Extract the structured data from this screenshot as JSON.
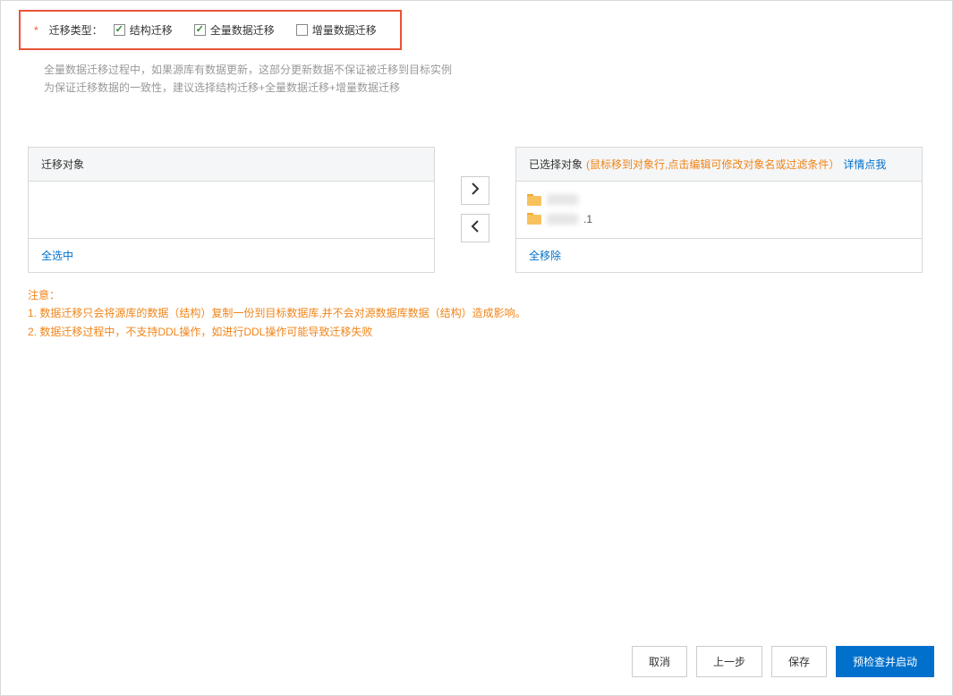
{
  "migration_type": {
    "label": "迁移类型：",
    "options": [
      {
        "label": "结构迁移",
        "checked": true
      },
      {
        "label": "全量数据迁移",
        "checked": true
      },
      {
        "label": "增量数据迁移",
        "checked": false
      }
    ]
  },
  "description": {
    "line1": "全量数据迁移过程中，如果源库有数据更新，这部分更新数据不保证被迁移到目标实例",
    "line2": "为保证迁移数据的一致性，建议选择结构迁移+全量数据迁移+增量数据迁移"
  },
  "left_panel": {
    "title": "迁移对象",
    "footer_action": "全选中"
  },
  "right_panel": {
    "title": "已选择对象",
    "hint": "(鼠标移到对象行,点击编辑可修改对象名或过滤条件）",
    "link": "详情点我",
    "items": [
      {
        "suffix": ""
      },
      {
        "suffix": ".1"
      }
    ],
    "footer_action": "全移除"
  },
  "notice": {
    "heading": "注意：",
    "line1": "1. 数据迁移只会将源库的数据（结构）复制一份到目标数据库,并不会对源数据库数据（结构）造成影响。",
    "line2": "2. 数据迁移过程中，不支持DDL操作，如进行DDL操作可能导致迁移失败"
  },
  "footer": {
    "cancel": "取消",
    "prev": "上一步",
    "save": "保存",
    "start": "预检查并启动"
  }
}
